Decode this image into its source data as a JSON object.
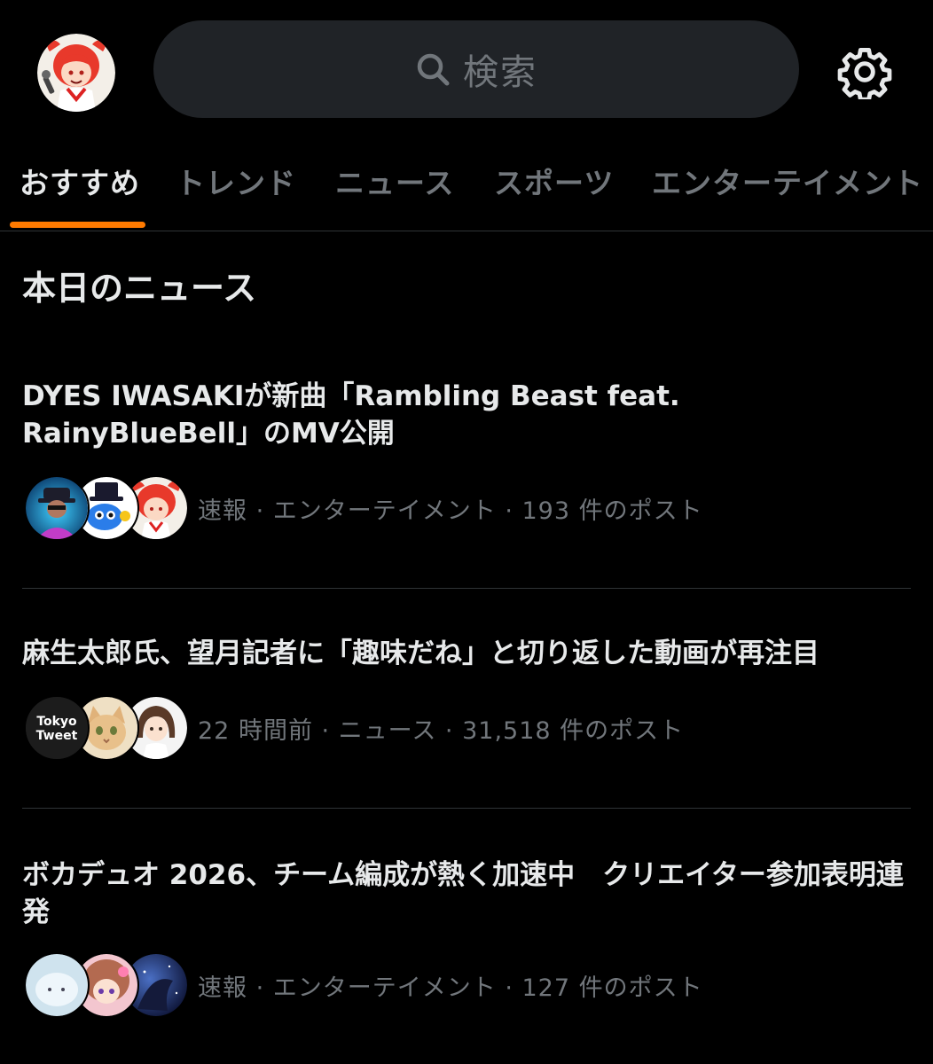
{
  "header": {
    "search": {
      "placeholder": "検索",
      "icon": "search-icon"
    },
    "settings_icon": "gear-icon"
  },
  "tabs": [
    {
      "label": "おすすめ",
      "active": true
    },
    {
      "label": "トレンド",
      "active": false
    },
    {
      "label": "ニュース",
      "active": false
    },
    {
      "label": "スポーツ",
      "active": false
    },
    {
      "label": "エンターテイメント",
      "active": false
    }
  ],
  "colors": {
    "accent": "#ff7a00",
    "background": "#000000",
    "text_primary": "#e7e9ea",
    "text_secondary": "#71767b",
    "search_bg": "#202327"
  },
  "section_title": "本日のニュース",
  "news": [
    {
      "title": "DYES IWASAKIが新曲「Rambling Beast feat. RainyBlueBell」のMV公開",
      "meta": "速報 · エンターテイメント · 193 件のポスト"
    },
    {
      "title": "麻生太郎氏、望月記者に「趣味だね」と切り返した動画が再注目",
      "meta": "22 時間前 · ニュース · 31,518 件のポスト",
      "avatar_text_line1": "Tokyo",
      "avatar_text_line2": "Tweet"
    },
    {
      "title": "ボカデュオ 2026、チーム編成が熱く加速中　クリエイター参加表明連発",
      "meta": "速報 · エンターテイメント · 127 件のポスト"
    }
  ]
}
